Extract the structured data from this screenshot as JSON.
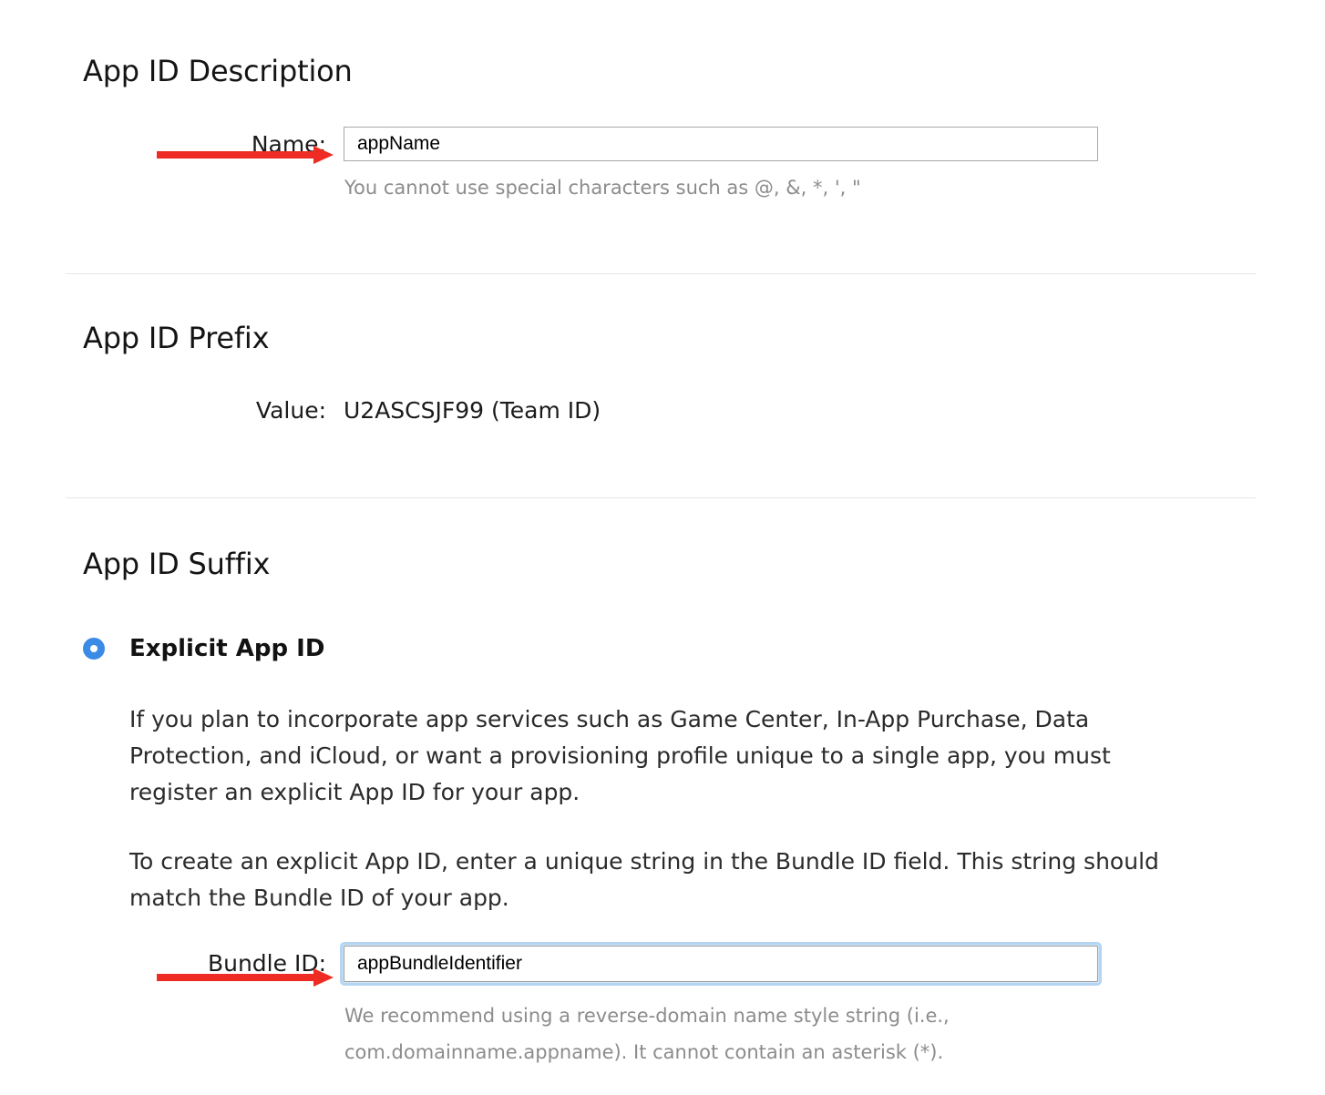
{
  "sections": {
    "description": {
      "title": "App ID Description",
      "name_label": "Name:",
      "name_value": "appName",
      "name_placeholder": "",
      "name_hint": "You cannot use special characters such as @, &, *, ', \""
    },
    "prefix": {
      "title": "App ID Prefix",
      "value_label": "Value:",
      "value_text": "U2ASCSJF99 (Team ID)"
    },
    "suffix": {
      "title": "App ID Suffix",
      "radio_label": "Explicit App ID",
      "radio_selected": true,
      "paragraph_1": "If you plan to incorporate app services such as Game Center, In-App Purchase, Data Protection, and iCloud, or want a provisioning profile unique to a single app, you must register an explicit App ID for your app.",
      "paragraph_2": "To create an explicit App ID, enter a unique string in the Bundle ID field. This string should match the Bundle ID of your app.",
      "bundle_label": "Bundle ID:",
      "bundle_value": "appBundleIdentifier",
      "bundle_placeholder": "",
      "bundle_hint": "We recommend using a reverse-domain name style string (i.e.,\ncom.domainname.appname). It cannot contain an asterisk (*)."
    }
  },
  "annotations": {
    "arrow_name_target": "Name field",
    "arrow_bundle_target": "Bundle ID field"
  },
  "colors": {
    "accent_radio": "#3b8ae6",
    "focus_ring": "#b5d6f2",
    "annotation_arrow": "#ee2c23",
    "hint_text": "#8c8c8c",
    "divider": "#e6e6e6"
  }
}
